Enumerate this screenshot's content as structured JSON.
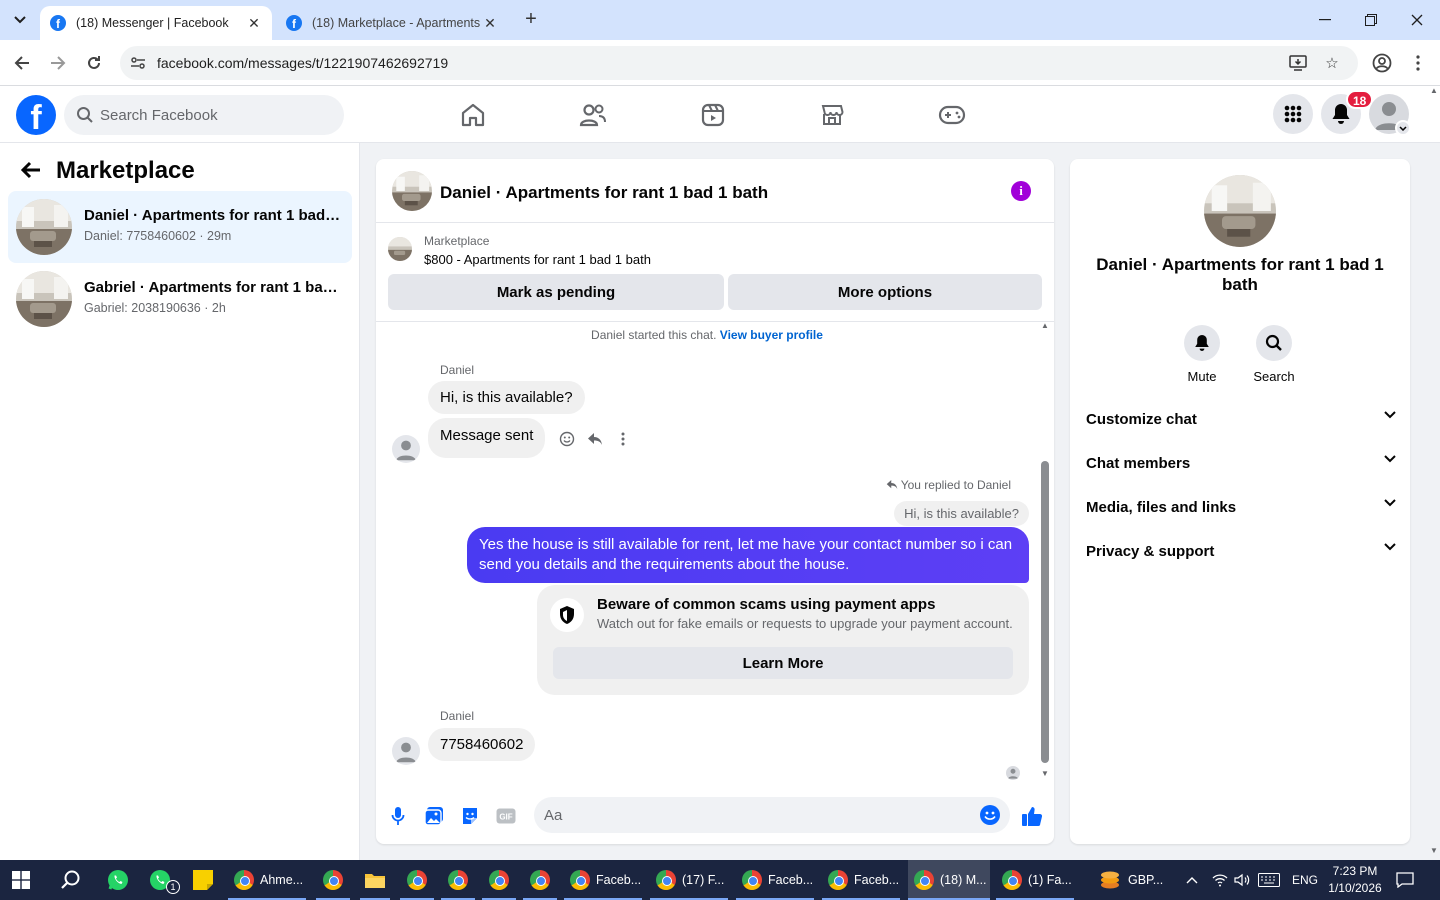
{
  "browser": {
    "tabs": [
      {
        "title": "(18) Messenger | Facebook"
      },
      {
        "title": "(18) Marketplace - Apartments"
      }
    ],
    "url": "facebook.com/messages/t/1221907462692719"
  },
  "fb_header": {
    "search_placeholder": "Search Facebook",
    "notification_count": "18"
  },
  "sidebar": {
    "title": "Marketplace",
    "conversations": [
      {
        "name": "Daniel · Apartments for rant 1 bad 1 bath",
        "sub": "Daniel: 7758460602 · 29m"
      },
      {
        "name": "Gabriel · Apartments for rant 1 bad 1 bath",
        "sub": "Gabriel: 2038190636 · 2h"
      }
    ]
  },
  "chat": {
    "title": "Daniel · Apartments for rant 1 bad 1 bath",
    "listing_label": "Marketplace",
    "listing_desc": "$800 - Apartments for rant 1 bad 1 bath",
    "mark_pending": "Mark as pending",
    "more_options": "More options",
    "system_text": "Daniel started this chat.",
    "system_link": "View buyer profile",
    "sender1": "Daniel",
    "msg1": "Hi, is this available?",
    "msg2": "Message sent",
    "reply_note": "You replied to Daniel",
    "quoted": "Hi, is this available?",
    "reply_text": "Yes the house is still available for rent, let me have your contact number so i can send you details and the requirements about the house.",
    "scam_title": "Beware of common scams using payment apps",
    "scam_sub": "Watch out for fake emails or requests to upgrade your payment account.",
    "learn_more": "Learn More",
    "sender2": "Daniel",
    "msg3": "7758460602",
    "composer_placeholder": "Aa"
  },
  "info": {
    "name": "Daniel · Apartments for rant 1 bad 1 bath",
    "mute": "Mute",
    "search": "Search",
    "rows": [
      "Customize chat",
      "Chat members",
      "Media, files and links",
      "Privacy & support"
    ]
  },
  "taskbar": {
    "items": [
      "Ahme...",
      "Faceb...",
      "(17) F...",
      "Faceb...",
      "Faceb...",
      "(18) M...",
      "(1) Fa...",
      "GBP..."
    ],
    "whatsapp_badge": "1",
    "lang": "ENG",
    "time": "7:23 PM",
    "date": "1/10/2026"
  },
  "colors": {
    "fb_blue": "#0866ff",
    "outgoing_bubble": "#5b3ff5",
    "badge_red": "#e41e3f",
    "info_purple": "#a100d9",
    "taskbar": "#1b2540"
  }
}
